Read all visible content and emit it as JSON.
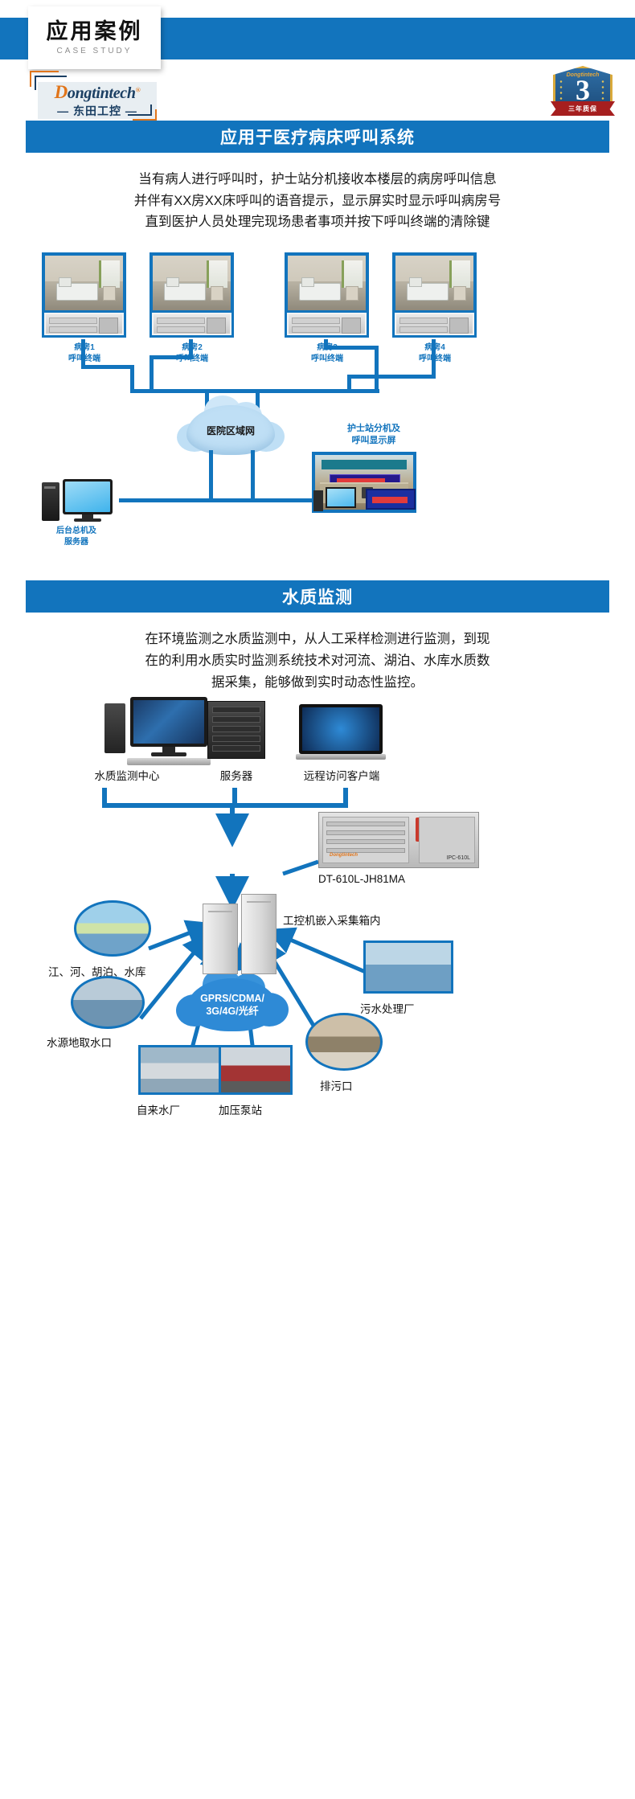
{
  "banner": {
    "title_cn": "应用案例",
    "title_en": "CASE STUDY"
  },
  "logo": {
    "brand_en": "Dongtintech",
    "registered_mark": "®",
    "brand_cn": "— 东田工控 —"
  },
  "badge": {
    "number": "3",
    "brand": "Dongtintech",
    "ribbon_text": "三年质保"
  },
  "sections": [
    {
      "id": "hospital",
      "header": "应用于医疗病床呼叫系统",
      "paragraph": [
        "当有病人进行呼叫时，护士站分机接收本楼层的病房呼叫信息",
        "并伴有XX房XX床呼叫的语音提示，显示屏实时显示呼叫病房号",
        "直到医护人员处理完现场患者事项并按下呼叫终端的清除键"
      ],
      "diagram": {
        "rooms": [
          {
            "label_line1": "病房1",
            "label_line2": "呼叫终端"
          },
          {
            "label_line1": "病房2",
            "label_line2": "呼叫终端"
          },
          {
            "label_line1": "病房3",
            "label_line2": "呼叫终端"
          },
          {
            "label_line1": "病房4",
            "label_line2": "呼叫终端"
          }
        ],
        "cloud_label": "医院区域网",
        "nurse_label_line1": "护士站分机及",
        "nurse_label_line2": "呼叫显示屏",
        "server_label_line1": "后台总机及",
        "server_label_line2": "服务器"
      }
    },
    {
      "id": "water",
      "header": "水质监测",
      "paragraph": [
        "在环境监测之水质监测中，从人工采样检测进行监测，到现",
        "在的利用水质实时监测系统技术对河流、湖泊、水库水质数",
        "据采集，能够做到实时动态性监控。"
      ],
      "diagram": {
        "top_nodes": [
          "水质监测中心",
          "服务器",
          "远程访问客户端"
        ],
        "network_line1": "GPRS/CDMA/",
        "network_line2": "3G/4G/光纤",
        "device_model": "DT-610L-JH81MA",
        "cabinet_label": "工控机嵌入采集箱内",
        "sources": [
          "江、河、胡泊、水库",
          "水源地取水口",
          "自来水厂",
          "加压泵站",
          "排污口",
          "污水处理厂"
        ]
      }
    }
  ],
  "colors": {
    "brand_blue": "#1274bd",
    "logo_orange": "#e1751b",
    "logo_navy": "#1b3f63",
    "badge_gold": "#d9a93b",
    "ribbon_red": "#a61f1f"
  }
}
